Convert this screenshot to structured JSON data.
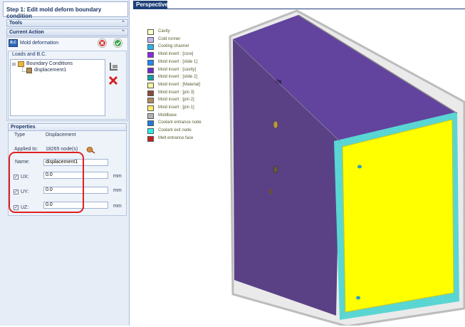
{
  "step_title": "Step 1: Edit mold deform boundary condition",
  "sections": {
    "tools": "Tools",
    "current_action": "Current Action",
    "loads_bc": "Loads and B.C.",
    "properties": "Properties"
  },
  "action": {
    "badge": "B.C",
    "label": "Mold deformation"
  },
  "tree": {
    "root": "Boundary Conditions",
    "child": "displacement1"
  },
  "properties": {
    "type_label": "Type",
    "type_value": "Displacement",
    "applied_label": "Applied to:",
    "applied_value": "18265 node(s)",
    "name_label": "Name:",
    "name_value": "displacement1",
    "ux_label": "UX:",
    "ux_value": "0.0",
    "uy_label": "UY:",
    "uy_value": "0.0",
    "uz_label": "UZ:",
    "uz_value": "0.0",
    "unit": "mm"
  },
  "viewport": {
    "tab": "Perspective"
  },
  "legend": [
    {
      "label": "Cavity",
      "color": "#ffffc8"
    },
    {
      "label": "Cold runner",
      "color": "#c8b4f0"
    },
    {
      "label": "Cooling channel",
      "color": "#28b4e6"
    },
    {
      "label": "Mold insert : [core]",
      "color": "#8c28e6"
    },
    {
      "label": "Mold insert : [slide 1]",
      "color": "#1e8cf0"
    },
    {
      "label": "Mold insert : [cavity]",
      "color": "#6e28c8"
    },
    {
      "label": "Mold insert : [slide 2]",
      "color": "#14a0aa"
    },
    {
      "label": "Mold insert : [Material]",
      "color": "#f5f5a0"
    },
    {
      "label": "Mold insert : [pin 3]",
      "color": "#8a4b3a"
    },
    {
      "label": "Mold insert : [pin 2]",
      "color": "#b08a5a"
    },
    {
      "label": "Mold insert : [pin 1]",
      "color": "#fff06e"
    },
    {
      "label": "Moldbase",
      "color": "#b4b4b4"
    },
    {
      "label": "Coolant entrance node",
      "color": "#1e78dc"
    },
    {
      "label": "Coolant exit node",
      "color": "#28f0f0"
    },
    {
      "label": "Melt entrance face",
      "color": "#c81e1e"
    }
  ]
}
